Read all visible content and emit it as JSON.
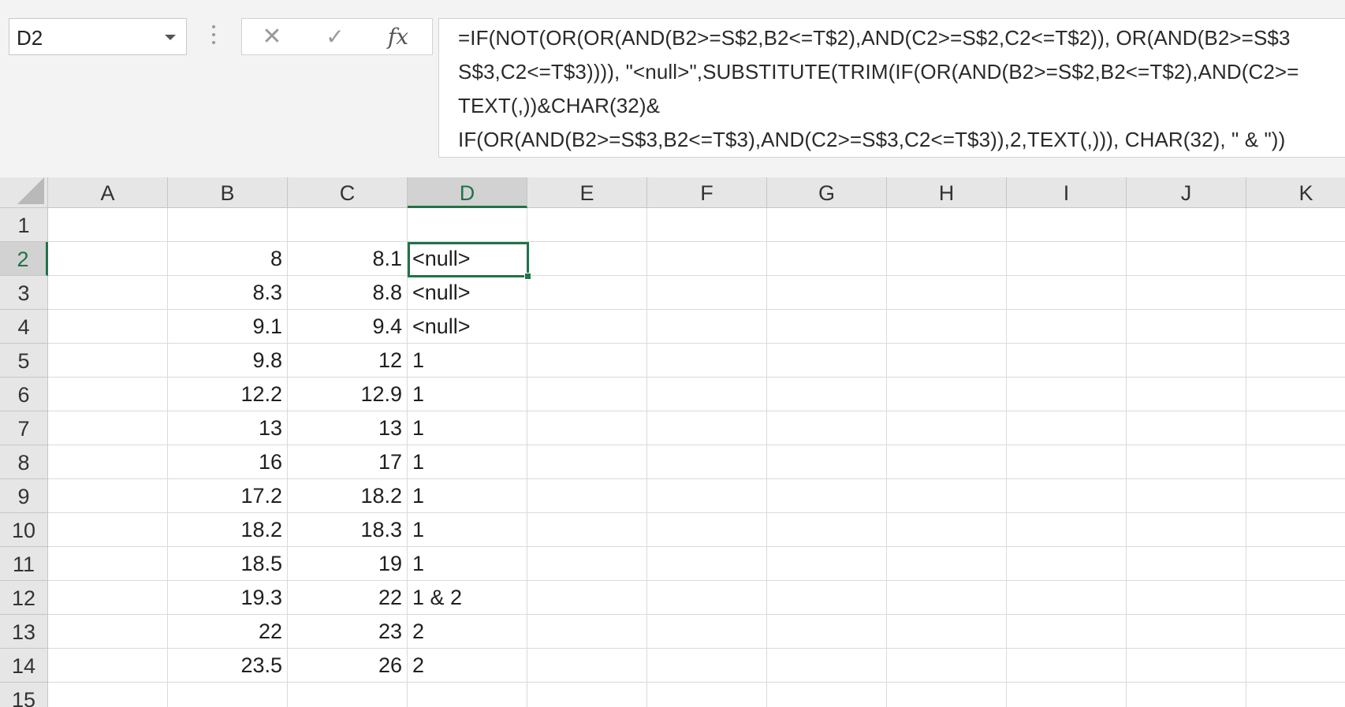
{
  "name_box": {
    "value": "D2"
  },
  "formula_bar": {
    "cancel_icon": "close-icon",
    "enter_icon": "check-icon",
    "fx_label": "fx",
    "lines": [
      "=IF(NOT(OR(OR(AND(B2>=S$2,B2<=T$2),AND(C2>=S$2,C2<=T$2)), OR(AND(B2>=S$3",
      "S$3,C2<=T$3)))), \"<null>\",SUBSTITUTE(TRIM(IF(OR(AND(B2>=S$2,B2<=T$2),AND(C2>=",
      "TEXT(,))&CHAR(32)&",
      "IF(OR(AND(B2>=S$3,B2<=T$3),AND(C2>=S$3,C2<=T$3)),2,TEXT(,))), CHAR(32), \" & \"))"
    ]
  },
  "columns": [
    "A",
    "B",
    "C",
    "D",
    "E",
    "F",
    "G",
    "H",
    "I",
    "J",
    "K"
  ],
  "selected_column": "D",
  "selected_row": "2",
  "rows": [
    {
      "num": "1",
      "b": "",
      "c": "",
      "d": ""
    },
    {
      "num": "2",
      "b": "8",
      "c": "8.1",
      "d": "<null>"
    },
    {
      "num": "3",
      "b": "8.3",
      "c": "8.8",
      "d": "<null>"
    },
    {
      "num": "4",
      "b": "9.1",
      "c": "9.4",
      "d": "<null>"
    },
    {
      "num": "5",
      "b": "9.8",
      "c": "12",
      "d": "1"
    },
    {
      "num": "6",
      "b": "12.2",
      "c": "12.9",
      "d": "1"
    },
    {
      "num": "7",
      "b": "13",
      "c": "13",
      "d": "1"
    },
    {
      "num": "8",
      "b": "16",
      "c": "17",
      "d": "1"
    },
    {
      "num": "9",
      "b": "17.2",
      "c": "18.2",
      "d": "1"
    },
    {
      "num": "10",
      "b": "18.2",
      "c": "18.3",
      "d": "1"
    },
    {
      "num": "11",
      "b": "18.5",
      "c": "19",
      "d": "1"
    },
    {
      "num": "12",
      "b": "19.3",
      "c": "22",
      "d": "1 & 2"
    },
    {
      "num": "13",
      "b": "22",
      "c": "23",
      "d": "2"
    },
    {
      "num": "14",
      "b": "23.5",
      "c": "26",
      "d": "2"
    },
    {
      "num": "15",
      "b": "",
      "c": "",
      "d": ""
    }
  ],
  "colors": {
    "accent": "#217346",
    "header_bg": "#e6e6e6",
    "selected_header_bg": "#d2d2d2"
  }
}
